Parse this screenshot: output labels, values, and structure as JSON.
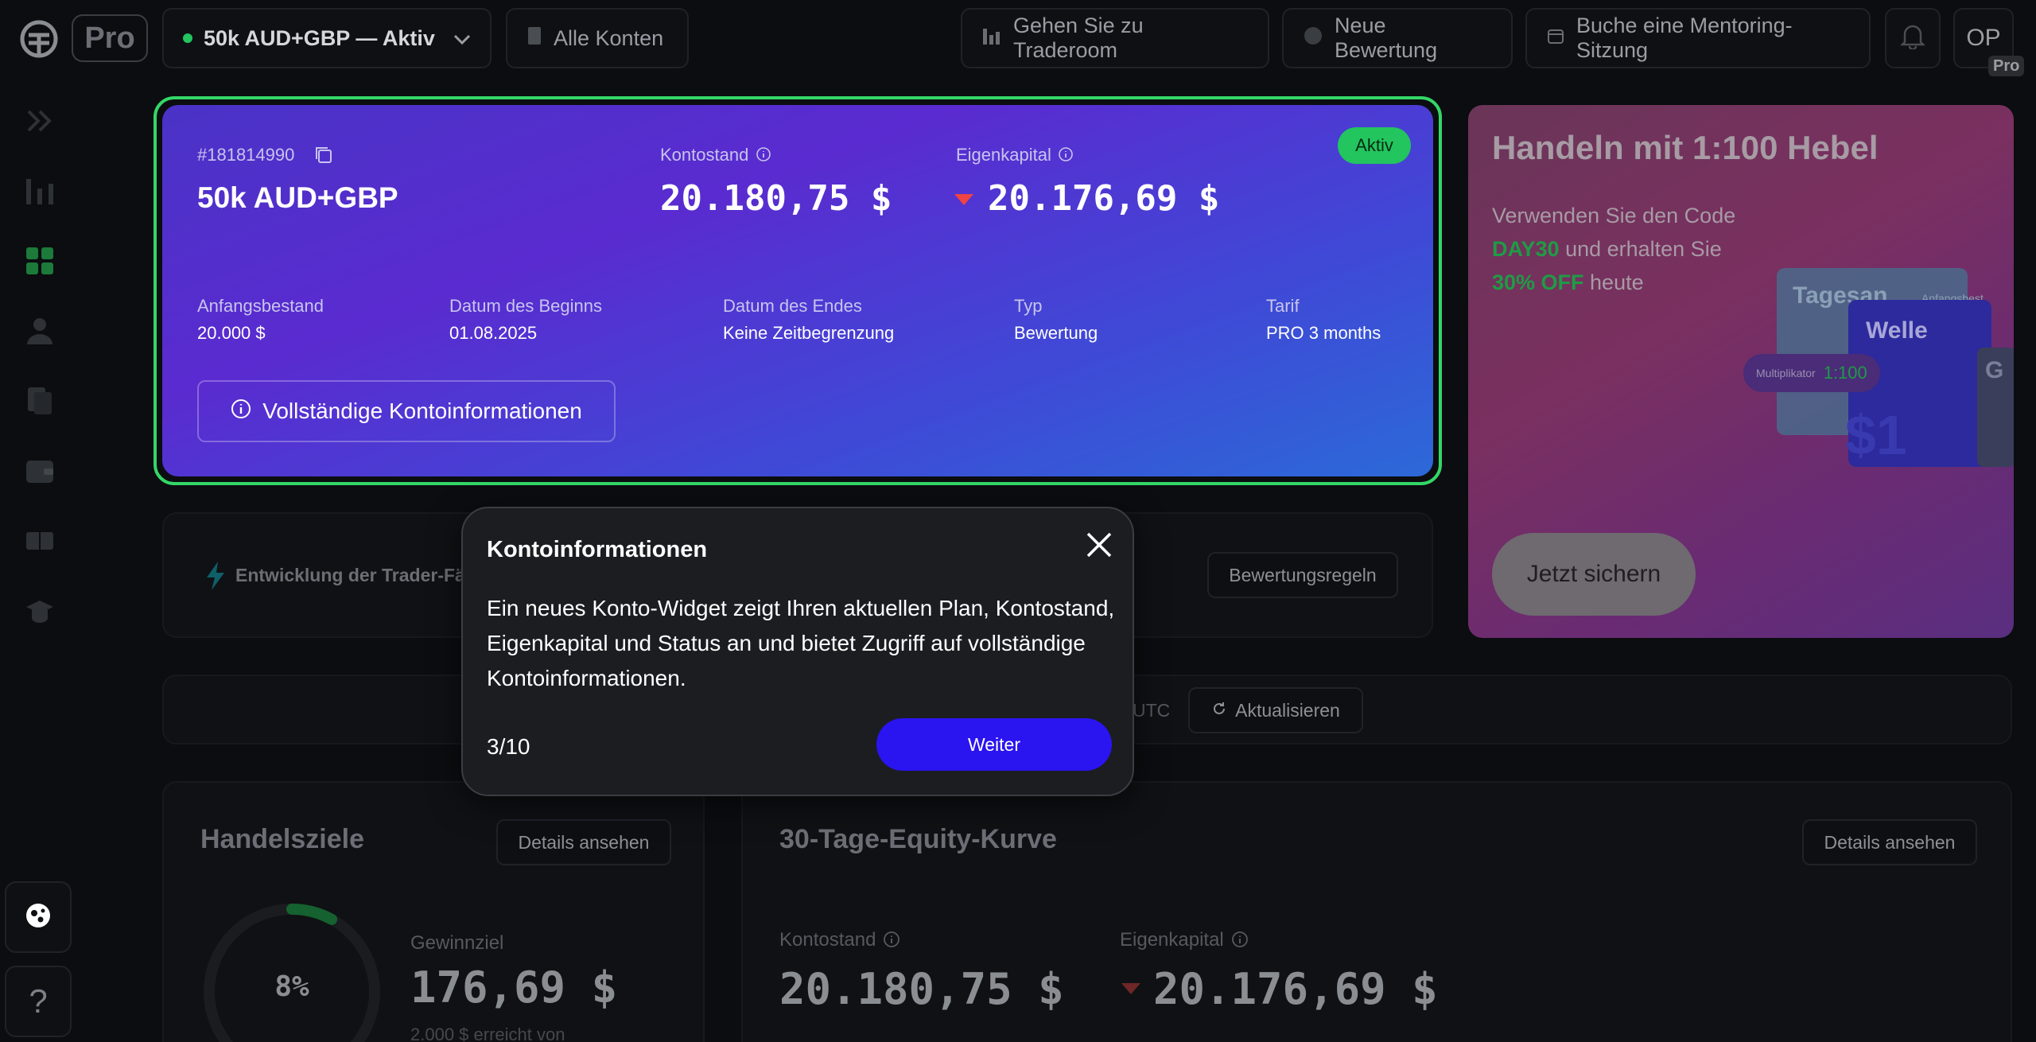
{
  "header": {
    "brand_badge": "Pro",
    "account_selector": {
      "label": "50k AUD+GBP — Aktiv",
      "status_color": "#22c55e"
    },
    "all_accounts_label": "Alle Konten",
    "traderoom_label": "Gehen Sie zu Traderoom",
    "new_evaluation_label": "Neue Bewertung",
    "mentoring_label": "Buche eine Mentoring-Sitzung",
    "avatar_initials": "OP",
    "avatar_badge": "Pro"
  },
  "sidebar": {
    "items": [
      "expand-icon",
      "chart-icon",
      "dashboard-icon",
      "user-icon",
      "documents-icon",
      "wallet-icon",
      "ticket-icon",
      "academy-icon"
    ],
    "active_item": "dashboard-icon",
    "help_label": "?"
  },
  "account_card": {
    "account_id": "#181814990",
    "account_name": "50k AUD+GBP",
    "balance_label": "Kontostand",
    "balance_value": "20.180,75 $",
    "equity_label": "Eigenkapital",
    "equity_value": "20.176,69 $",
    "status_badge": "Aktiv",
    "details": [
      {
        "label": "Anfangsbestand",
        "value": "20.000 $"
      },
      {
        "label": "Datum des Beginns",
        "value": "01.08.2025"
      },
      {
        "label": "Datum des Endes",
        "value": "Keine Zeitbegrenzung"
      },
      {
        "label": "Typ",
        "value": "Bewertung"
      },
      {
        "label": "Tarif",
        "value": "PRO 3 months"
      }
    ],
    "full_info_button": "Vollständige Kontoinformationen",
    "highlight_color": "#34d667"
  },
  "promo": {
    "title": "Handeln mit 1:100 Hebel",
    "line1": "Verwenden Sie den Code",
    "code": "DAY30",
    "line2_rest": " und erhalten Sie",
    "discount": "30% OFF",
    "line3_rest": " heute",
    "cta": "Jetzt sichern",
    "deco": {
      "card1": "Tagesan",
      "card1_small": "Anfangsbest",
      "card2": "Welle",
      "multiplier_label": "Multiplikator",
      "multiplier_value": "1:100",
      "big_amount": "$1",
      "card3": "G"
    }
  },
  "skill_row": {
    "label": "Entwicklung der Trader-Fäh",
    "rules_button": "Bewertungsregeln"
  },
  "update_row": {
    "timezone": "UTC",
    "refresh_button": "Aktualisieren"
  },
  "trading_goals": {
    "title": "Handelsziele",
    "details_button": "Details ansehen",
    "progress_percent": 8,
    "progress_label": "8%",
    "profit_goal_label": "Gewinnziel",
    "profit_goal_value": "176,69 $",
    "profit_goal_sub": "2.000 $ erreicht von"
  },
  "equity_curve": {
    "title": "30-Tage-Equity-Kurve",
    "details_button": "Details ansehen",
    "balance_label": "Kontostand",
    "balance_value": "20.180,75 $",
    "equity_label": "Eigenkapital",
    "equity_value": "20.176,69 $"
  },
  "tooltip": {
    "title": "Kontoinformationen",
    "body": "Ein neues Konto-Widget zeigt Ihren aktuellen Plan, Kontostand, Eigenkapital und Status an und bietet Zugriff auf vollständige Kontoinformationen.",
    "step": "3/10",
    "next_button": "Weiter"
  }
}
